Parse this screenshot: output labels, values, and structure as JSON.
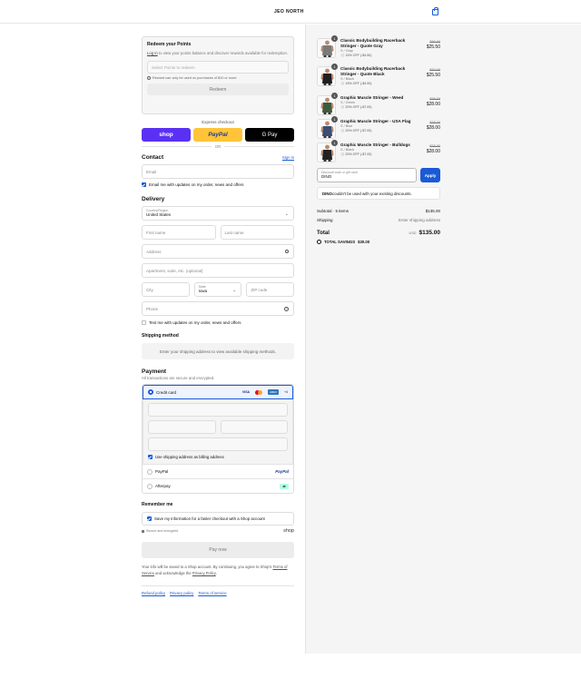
{
  "header": {
    "logo": "JEO NORTH",
    "cart_icon": "bag-icon"
  },
  "redeem": {
    "title": "Redeem your Points",
    "login_link": "Log in",
    "desc": " to view your points balance and discover rewards available for redemption.",
    "select_placeholder": "Select Points to redeem",
    "info": "Reward can only be used on purchases of $10 or more",
    "button": "Redeem"
  },
  "express": {
    "label": "Express checkout",
    "shop": "shop",
    "paypal": "PayPal",
    "gpay": "G Pay",
    "or": "OR"
  },
  "contact": {
    "title": "Contact",
    "signin": "Sign in",
    "email_placeholder": "Email",
    "newsletter": "Email me with updates on my order, news and offers"
  },
  "delivery": {
    "title": "Delivery",
    "country_label": "Country/Region",
    "country": "United States",
    "first_name": "First name",
    "last_name": "Last name",
    "address": "Address",
    "apartment": "Apartment, suite, etc. (optional)",
    "city": "City",
    "state_label": "State",
    "state": "Iowa",
    "zip": "ZIP code",
    "phone": "Phone",
    "sms": "Text me with updates on my order, news and offers"
  },
  "shipping": {
    "title": "Shipping method",
    "message": "Enter your shipping address to view available shipping methods."
  },
  "payment": {
    "title": "Payment",
    "subtitle": "All transactions are secure and encrypted.",
    "credit_card": "Credit card",
    "card_brands": [
      "VISA",
      "MC",
      "AMEX",
      "+4"
    ],
    "billing_same": "Use shipping address as billing address",
    "paypal": "PayPal",
    "paypal_logo": "PayPal",
    "afterpay": "Afterpay"
  },
  "remember": {
    "title": "Remember me",
    "save_info": "Save my information for a faster checkout with a Shop account",
    "secure": "Secure and encrypted",
    "shop": "shop"
  },
  "pay_button": "Pay now",
  "disclaimer": {
    "prefix": "Your info will be saved to a Shop account. By continuing, you agree to Shop's ",
    "tos": "Terms of Service",
    "mid": " and acknowledge the ",
    "privacy": "Privacy Policy",
    "suffix": "."
  },
  "footer": [
    "Refund policy",
    "Privacy policy",
    "Terms of service"
  ],
  "cart": {
    "items": [
      {
        "qty": "1",
        "name": "Classic Bodybuilding Racerback Stringer - Quote Gray",
        "variant": "S / Gray",
        "discount": "15% OFF (-$4.50)",
        "old": "$30.00",
        "price": "$25.50",
        "color": "#7a7a7a"
      },
      {
        "qty": "1",
        "name": "Classic Bodybuilding Racerback Stringer - Quote Black",
        "variant": "S / Black",
        "discount": "15% OFF (-$4.50)",
        "old": "$30.00",
        "price": "$25.50",
        "color": "#1e1e1e"
      },
      {
        "qty": "1",
        "name": "Graphic Muscle Stringer - Weed",
        "variant": "S / Green",
        "discount": "20% OFF (-$7.00)",
        "old": "$35.00",
        "price": "$28.00",
        "color": "#3f5a3c"
      },
      {
        "qty": "1",
        "name": "Graphic Muscle Stringer - USA Flag",
        "variant": "S / Blue",
        "discount": "20% OFF (-$7.00)",
        "old": "$35.00",
        "price": "$28.00",
        "color": "#3c4c74"
      },
      {
        "qty": "1",
        "name": "Graphic Muscle Stringer - Bulldogs",
        "variant": "S / Black",
        "discount": "20% OFF (-$7.00)",
        "old": "$35.00",
        "price": "$28.00",
        "color": "#222222"
      }
    ],
    "discount_label": "Discount code or gift card",
    "discount_value": "DINO",
    "apply": "Apply",
    "error_code": "DINO",
    "error_text": " couldn't be used with your existing discounts.",
    "subtotal_label": "Subtotal · 5 items",
    "subtotal": "$135.00",
    "shipping_label": "Shipping",
    "shipping_value": "Enter shipping address",
    "total_label": "Total",
    "currency": "USD",
    "total": "$135.00",
    "savings_label": "TOTAL SAVINGS",
    "savings": "$30.00"
  },
  "colors": {
    "accent": "#1a5ad6",
    "shop": "#5a31f4",
    "paypal": "#ffc439"
  }
}
